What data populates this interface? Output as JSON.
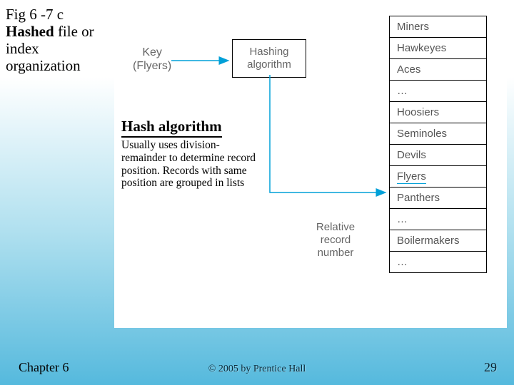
{
  "title": {
    "line1": "Fig 6 -7 c",
    "line2_bold": "Hashed",
    "line2_rest": " file or",
    "line3": "index",
    "line4": "organization"
  },
  "diagram": {
    "key_label": "Key",
    "key_example": "(Flyers)",
    "hash_box_l1": "Hashing",
    "hash_box_l2": "algorithm",
    "relative_l1": "Relative",
    "relative_l2": "record",
    "relative_l3": "number",
    "records": [
      "Miners",
      "Hawkeyes",
      "Aces",
      "…",
      "Hoosiers",
      "Seminoles",
      "Devils",
      "Flyers",
      "Panthers",
      "…",
      "Boilermakers",
      "…"
    ],
    "highlight_index": 7
  },
  "algo": {
    "heading": "Hash algorithm",
    "body": "Usually uses division-remainder to determine record position. Records with same position are grouped in lists"
  },
  "footer": {
    "chapter": "Chapter 6",
    "copyright": "© 2005 by Prentice Hall",
    "page": "29"
  },
  "colors": {
    "arrow": "#00a0d8"
  }
}
